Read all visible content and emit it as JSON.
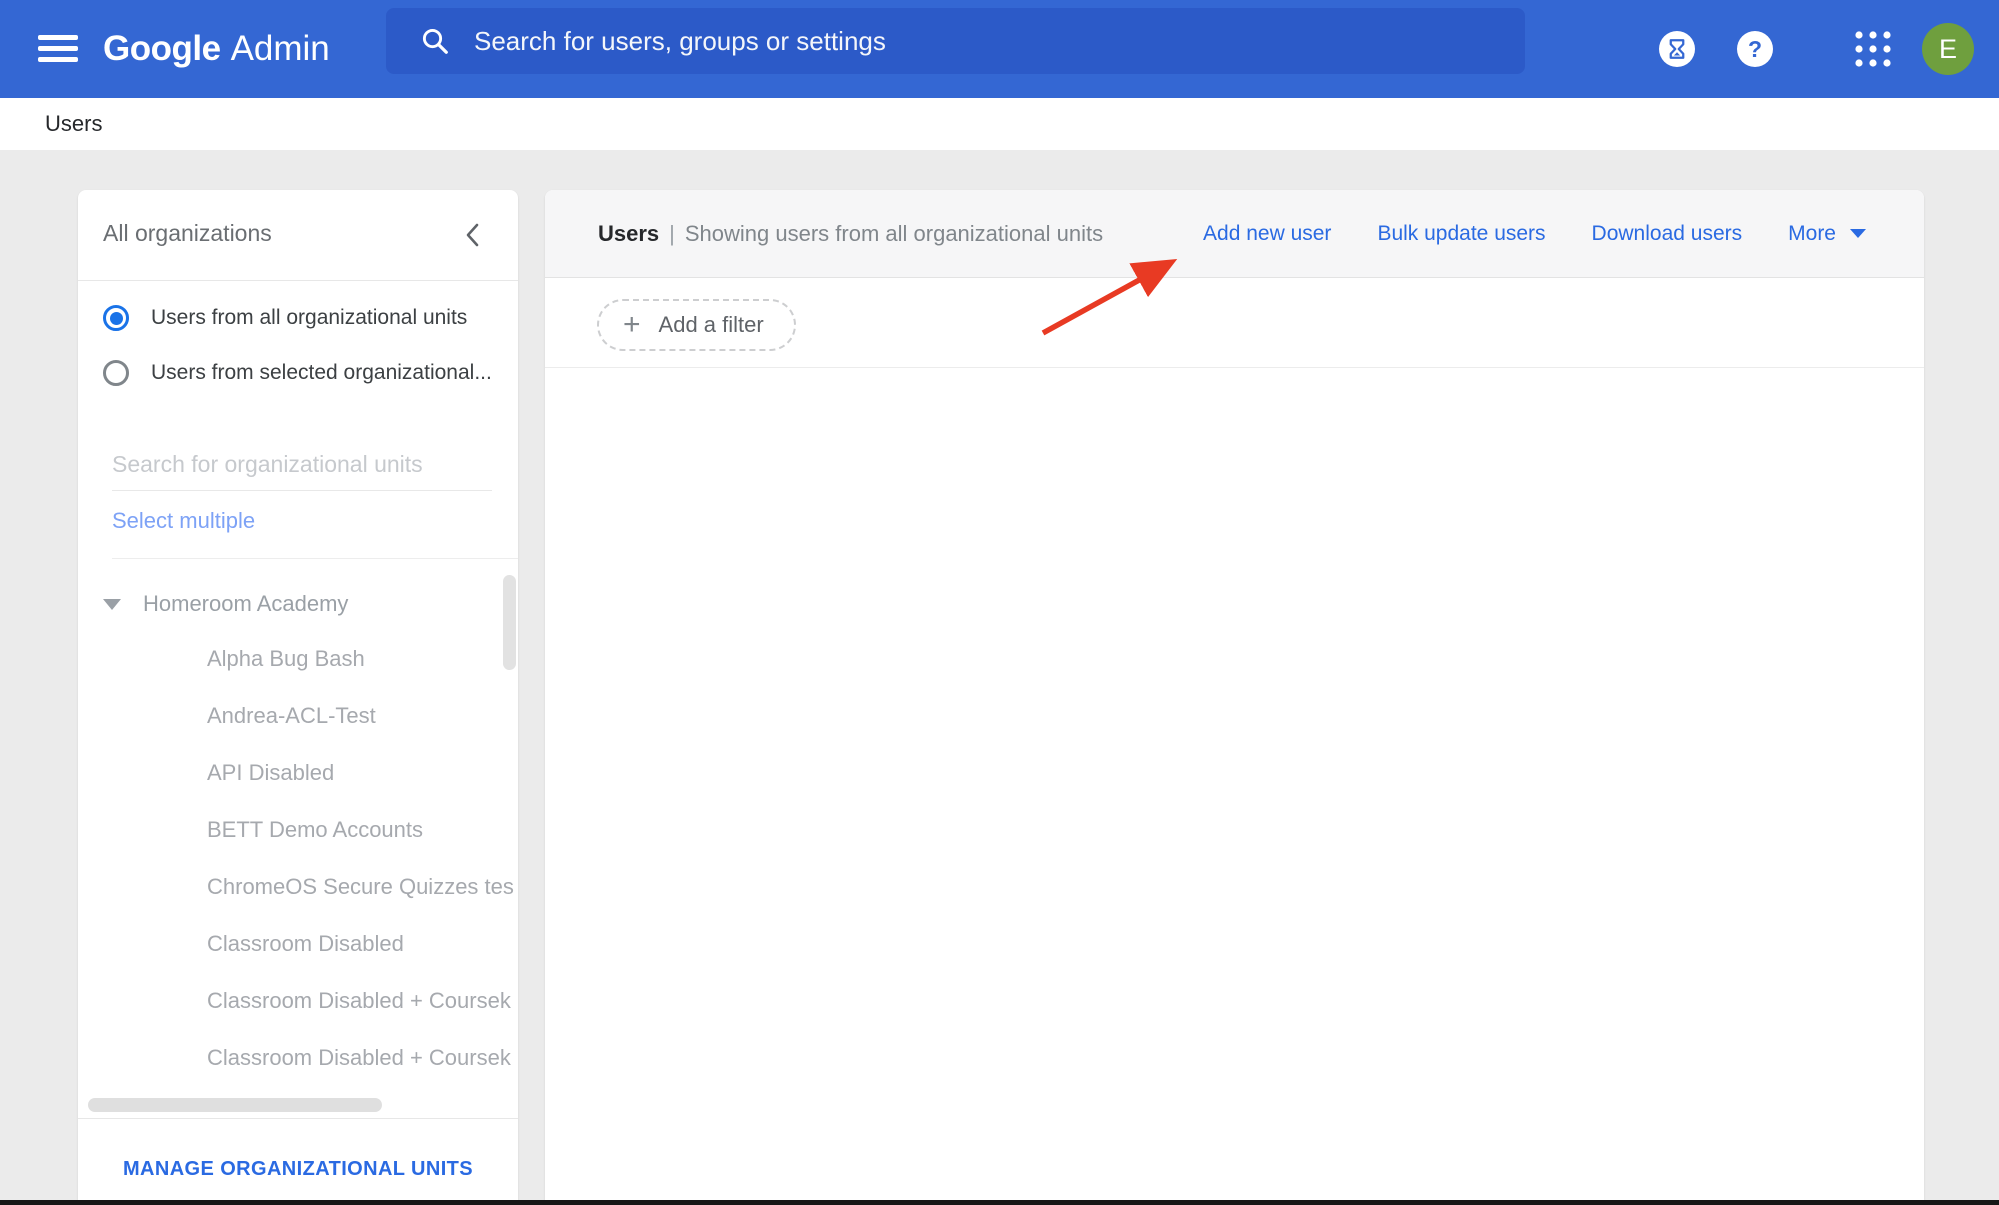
{
  "topbar": {
    "logo_primary": "Google",
    "logo_secondary": "Admin",
    "search_placeholder": "Search for users, groups or settings",
    "avatar_initial": "E",
    "help_glyph": "?"
  },
  "breadcrumb": {
    "label": "Users"
  },
  "sidebar": {
    "title": "All organizations",
    "radios": [
      {
        "label": "Users from all organizational units",
        "selected": true
      },
      {
        "label": "Users from selected organizational...",
        "selected": false
      }
    ],
    "search_placeholder": "Search for organizational units",
    "select_multiple_label": "Select multiple",
    "tree_root": "Homeroom Academy",
    "tree_items": [
      "Alpha Bug Bash",
      "Andrea-ACL-Test",
      "API Disabled",
      "BETT Demo Accounts",
      "ChromeOS Secure Quizzes tes",
      "Classroom Disabled",
      "Classroom Disabled + Coursek",
      "Classroom Disabled + Coursek"
    ],
    "manage_button": "MANAGE ORGANIZATIONAL UNITS"
  },
  "main": {
    "title": "Users",
    "separator": "|",
    "subtitle": "Showing users from all organizational units",
    "actions": [
      {
        "label": "Add new user"
      },
      {
        "label": "Bulk update users"
      },
      {
        "label": "Download users"
      },
      {
        "label": "More"
      }
    ],
    "filter_button": "Add a filter"
  },
  "colors": {
    "topbar_blue": "#3467d3",
    "searchbox_blue": "#2c5ac8",
    "link_blue": "#2a6ae2",
    "radio_selected_blue": "#1a73e8",
    "select_multiple_blue": "#7da2f6",
    "avatar_green": "#6f9f3e",
    "arrow_red": "#e83a23",
    "page_background": "#ebebeb"
  }
}
